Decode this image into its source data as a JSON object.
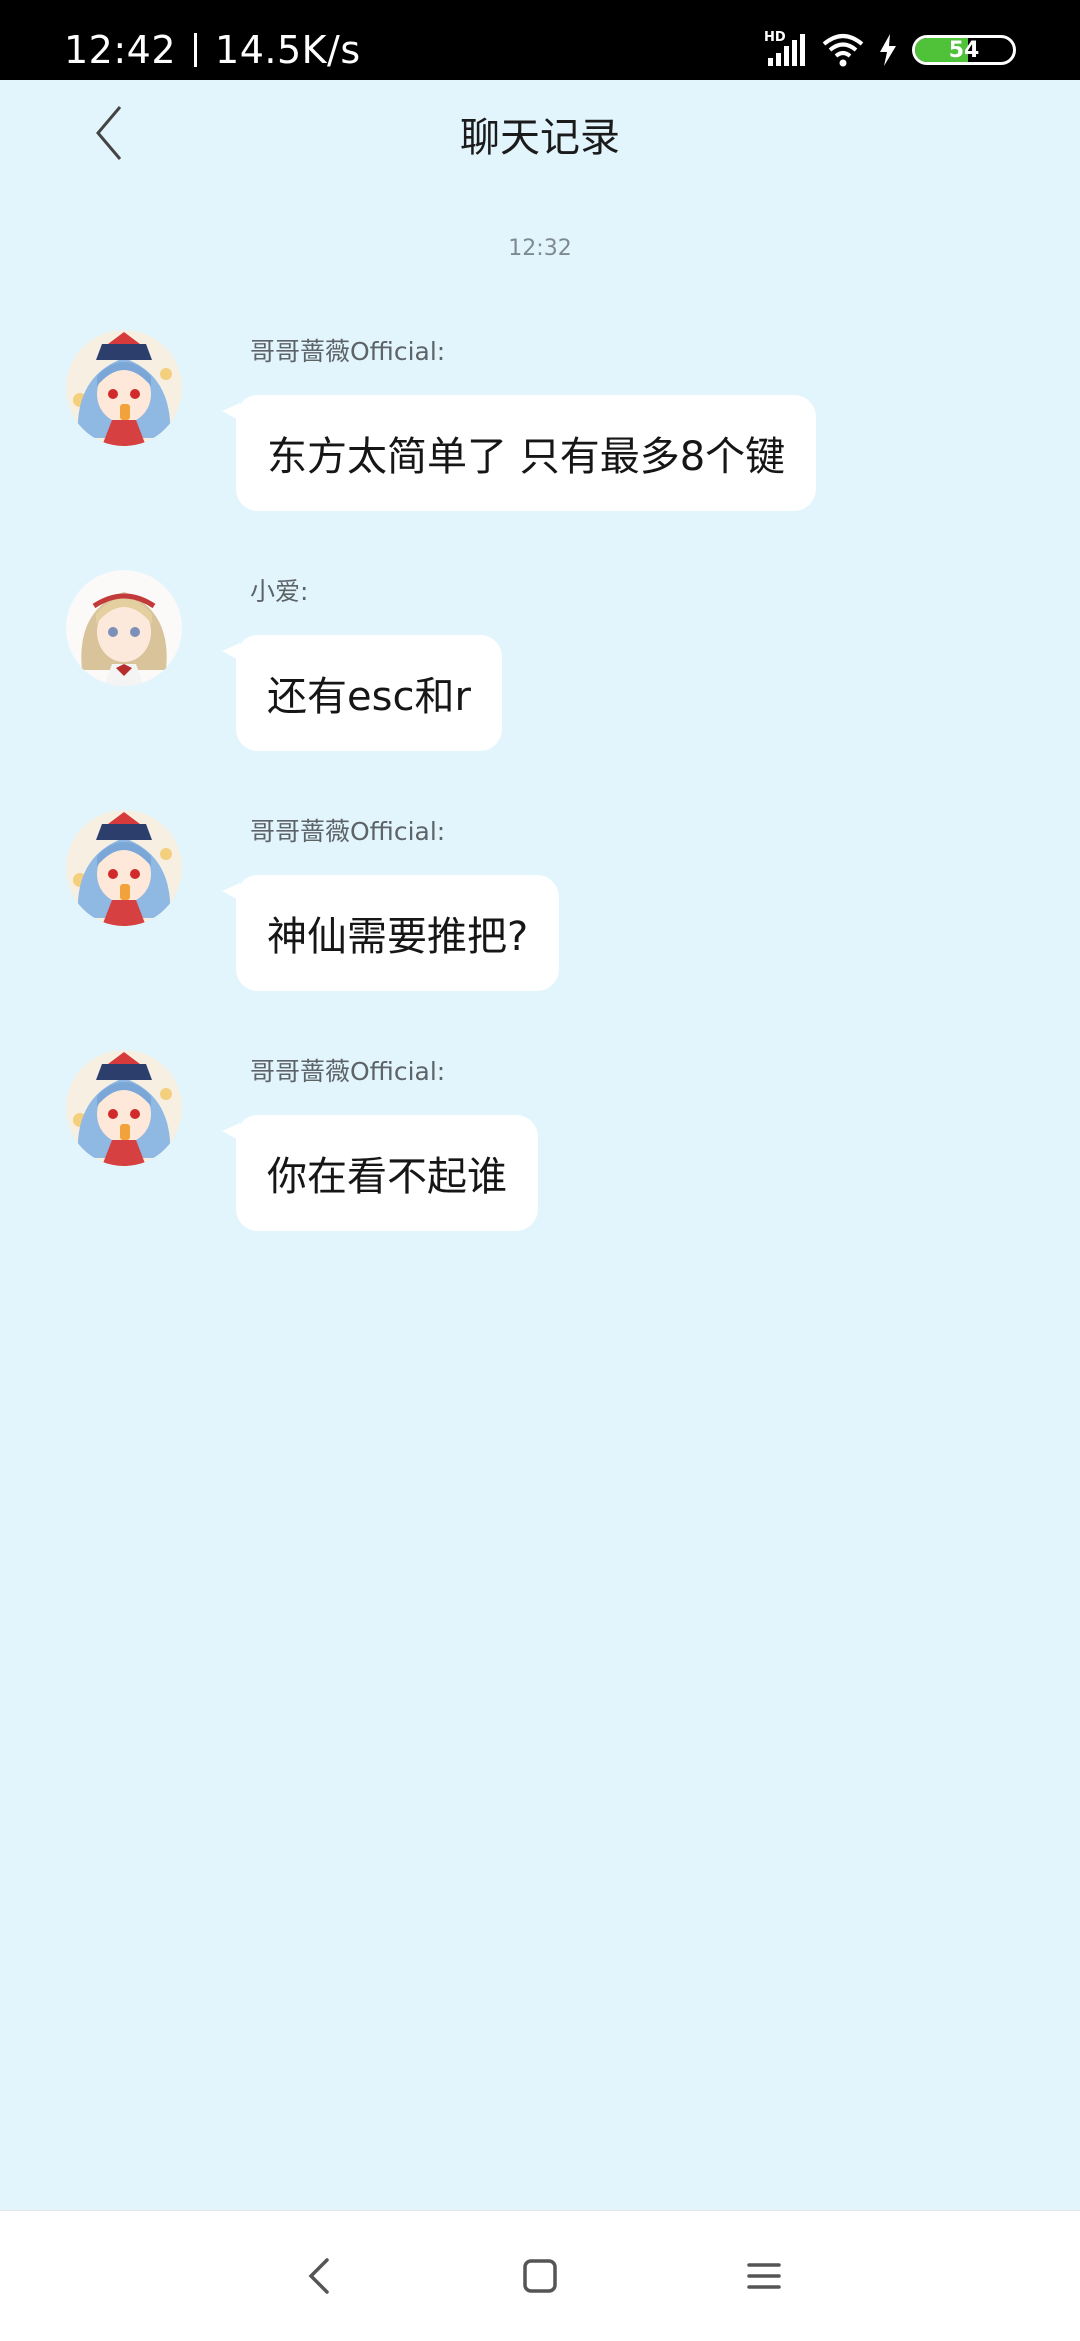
{
  "status_bar": {
    "time": "12:42",
    "network_speed": "14.5K/s",
    "network_type": "HD",
    "battery_level": "54",
    "battery_fraction": 0.54,
    "icons": [
      "hd-signal-icon",
      "wifi-icon",
      "charging-icon",
      "battery-icon"
    ]
  },
  "header": {
    "title": "聊天记录",
    "back_icon": "chevron-left-icon"
  },
  "chat": {
    "timestamp": "12:32",
    "messages": [
      {
        "sender": "哥哥蔷薇Official:",
        "text": "东方太简单了  只有最多8个键",
        "avatar": "blue-hair-girl-avatar"
      },
      {
        "sender": "小爱:",
        "text": "还有esc和r",
        "avatar": "blonde-girl-avatar"
      },
      {
        "sender": "哥哥蔷薇Official:",
        "text": "神仙需要推把?",
        "avatar": "blue-hair-girl-avatar"
      },
      {
        "sender": "哥哥蔷薇Official:",
        "text": "你在看不起谁",
        "avatar": "blue-hair-girl-avatar"
      }
    ]
  },
  "nav_bar": {
    "buttons": [
      "back-icon",
      "home-icon",
      "menu-icon"
    ]
  },
  "colors": {
    "background": "#e2f5fd",
    "bubble": "#ffffff",
    "battery_fill": "#4fc23a"
  }
}
